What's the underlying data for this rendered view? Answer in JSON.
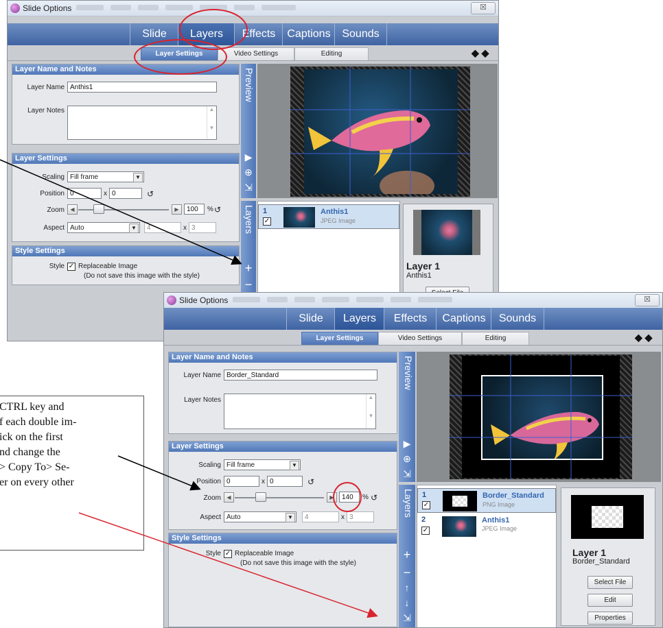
{
  "window_title": "Slide Options",
  "nav_tabs": [
    "Slide",
    "Layers",
    "Effects",
    "Captions",
    "Sounds"
  ],
  "sub_tabs": [
    "Layer Settings",
    "Video Settings",
    "Editing"
  ],
  "close_label": "☒",
  "nav_arrows": "◆ ◆",
  "sections": {
    "name_notes": "Layer Name and Notes",
    "layer_settings": "Layer Settings",
    "style_settings": "Style Settings"
  },
  "labels": {
    "layer_name": "Layer Name",
    "layer_notes": "Layer Notes",
    "scaling": "Scaling",
    "position": "Position",
    "zoom": "Zoom",
    "aspect": "Aspect",
    "style": "Style",
    "x": "x",
    "percent": "%",
    "replaceable": "Replaceable Image",
    "do_not_save": "(Do not save this image with the style)"
  },
  "strip_labels": {
    "preview": "Preview",
    "layers": "Layers"
  },
  "top_window": {
    "layer_name": "Anthis1",
    "scaling": "Fill frame",
    "pos_x": "0",
    "pos_y": "0",
    "zoom": "100",
    "aspect": "Auto",
    "aspect_w": "4",
    "aspect_h": "3",
    "layers": [
      {
        "num": "1",
        "name": "Anthis1",
        "type": "JPEG Image"
      }
    ],
    "prop_title": "Layer 1",
    "prop_sub": "Anthis1",
    "buttons": [
      "Select File"
    ]
  },
  "bottom_window": {
    "layer_name": "Border_Standard",
    "scaling": "Fill frame",
    "pos_x": "0",
    "pos_y": "0",
    "zoom": "140",
    "aspect": "Auto",
    "aspect_w": "4",
    "aspect_h": "3",
    "layers": [
      {
        "num": "1",
        "name": "Border_Standard",
        "type": "PNG Image"
      },
      {
        "num": "2",
        "name": "Anthis1",
        "type": "JPEG Image"
      }
    ],
    "prop_title": "Layer 1",
    "prop_sub": "Border_Standard",
    "buttons": [
      "Select File",
      "Edit",
      "Properties"
    ]
  },
  "note_lines": [
    "CTRL key and",
    "f each double im-",
    "ick on the first",
    "nd change the",
    "> Copy To> Se-",
    "er on every other"
  ],
  "colors": {
    "accent": "#4e74b6",
    "annotation_red": "#d9232f",
    "arrow": "#000000"
  }
}
